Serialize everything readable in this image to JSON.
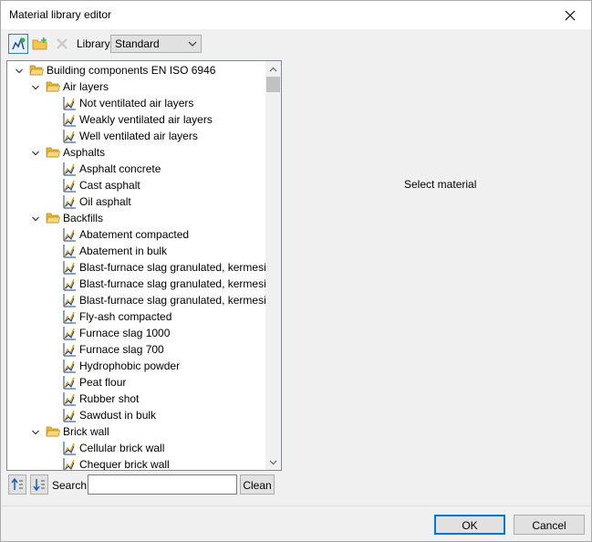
{
  "window": {
    "title": "Material library editor"
  },
  "toolbar": {
    "library_label": "Library:",
    "library_value": "Standard"
  },
  "tree": {
    "root": "Building components EN ISO 6946",
    "groups": [
      {
        "label": "Air layers",
        "items": [
          "Not ventilated air layers",
          "Weakly ventilated air layers",
          "Well ventilated air layers"
        ]
      },
      {
        "label": "Asphalts",
        "items": [
          "Asphalt concrete",
          "Cast asphalt",
          "Oil asphalt"
        ]
      },
      {
        "label": "Backfills",
        "items": [
          "Abatement compacted",
          "Abatement in bulk",
          "Blast-furnace slag granulated, kermesite ...",
          "Blast-furnace slag granulated, kermesite ...",
          "Blast-furnace slag granulated, kermesite ...",
          "Fly-ash compacted",
          "Furnace slag 1000",
          "Furnace slag 700",
          "Hydrophobic powder",
          "Peat flour",
          "Rubber shot",
          "Sawdust in bulk"
        ]
      },
      {
        "label": "Brick wall",
        "items": [
          "Cellular brick wall",
          "Chequer brick wall"
        ]
      }
    ]
  },
  "detail": {
    "placeholder": "Select material"
  },
  "search": {
    "label": "Search:",
    "value": "",
    "clean_label": "Clean"
  },
  "buttons": {
    "ok": "OK",
    "cancel": "Cancel"
  },
  "colors": {
    "accent": "#0078d7",
    "folder": "#f4c64f",
    "material_icon": "#1a3f8f"
  }
}
